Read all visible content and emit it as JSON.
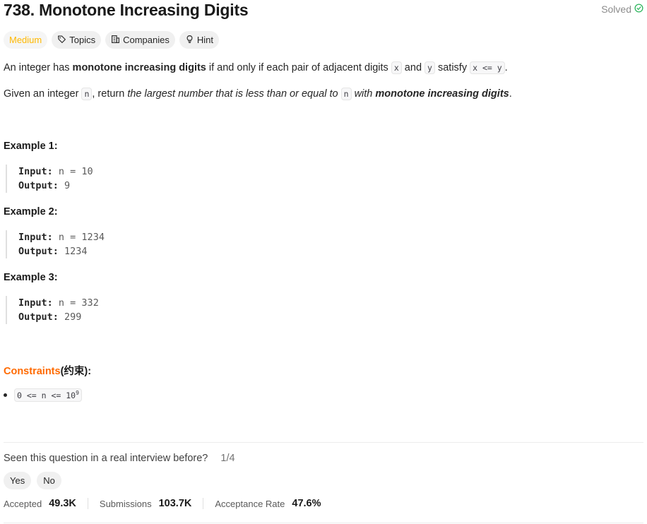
{
  "problem": {
    "title": "738. Monotone Increasing Digits",
    "solved_label": "Solved"
  },
  "tags": {
    "difficulty": "Medium",
    "topics": "Topics",
    "companies": "Companies",
    "hint": "Hint"
  },
  "description": {
    "p1_a": "An integer has ",
    "p1_b": "monotone increasing digits",
    "p1_c": " if and only if each pair of adjacent digits ",
    "p1_x": "x",
    "p1_d": " and ",
    "p1_y": "y",
    "p1_e": " satisfy ",
    "p1_cond": "x <= y",
    "p1_f": ".",
    "p2_a": "Given an integer ",
    "p2_n": "n",
    "p2_b": ", return ",
    "p2_c": "the largest number that is less than or equal to ",
    "p2_n2": "n",
    "p2_d": " with ",
    "p2_e": "monotone increasing digits",
    "p2_f": "."
  },
  "examples": [
    {
      "title": "Example 1:",
      "input_label": "Input:",
      "input": "n = 10",
      "output_label": "Output:",
      "output": "9"
    },
    {
      "title": "Example 2:",
      "input_label": "Input:",
      "input": "n = 1234",
      "output_label": "Output:",
      "output": "1234"
    },
    {
      "title": "Example 3:",
      "input_label": "Input:",
      "input": "n = 332",
      "output_label": "Output:",
      "output": "299"
    }
  ],
  "constraints": {
    "label": "Constraints",
    "label_cn": "(约束):",
    "item_base": "0 <= n <= 10",
    "item_exp": "9"
  },
  "feedback": {
    "question": "Seen this question in a real interview before?",
    "fraction": "1/4",
    "yes": "Yes",
    "no": "No"
  },
  "stats": {
    "accepted_label": "Accepted",
    "accepted": "49.3K",
    "submissions_label": "Submissions",
    "submissions": "103.7K",
    "rate_label": "Acceptance Rate",
    "rate": "47.6%"
  },
  "colors": {
    "medium": "#ffb800",
    "solved_check": "#2db55d",
    "constraints": "#ff6a00"
  }
}
